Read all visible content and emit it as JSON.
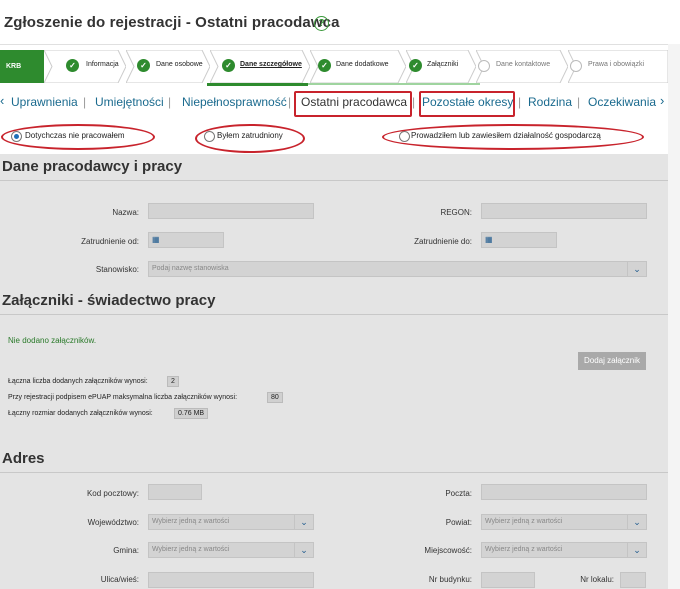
{
  "header": {
    "title": "Zgłoszenie do rejestracji - Ostatni pracodawca"
  },
  "steps": {
    "krb": "KRB",
    "items": [
      {
        "label": "Informacja"
      },
      {
        "label": "Dane osobowe"
      },
      {
        "label": "Dane szczegółowe"
      },
      {
        "label": "Dane dodatkowe"
      },
      {
        "label": "Załączniki"
      },
      {
        "label": "Dane kontaktowe"
      },
      {
        "label": "Prawa i obowiązki"
      }
    ]
  },
  "tabs": {
    "prev": "‹",
    "next": "›",
    "items": [
      "Uprawnienia",
      "Umiejętności",
      "Niepełnosprawność",
      "Ostatni pracodawca",
      "Pozostałe okresy",
      "Rodzina",
      "Oczekiwania"
    ]
  },
  "employment": {
    "options": [
      "Dotychczas nie pracowałem",
      "Byłem zatrudniony",
      "Prowadziłem lub zawiesiłem działalność gospodarczą"
    ]
  },
  "employer": {
    "title": "Dane pracodawcy i pracy",
    "name_label": "Nazwa:",
    "regon_label": "REGON:",
    "from_label": "Zatrudnienie od:",
    "to_label": "Zatrudnienie do:",
    "position_label": "Stanowisko:",
    "position_placeholder": "Podaj nazwę stanowiska"
  },
  "attachments": {
    "title": "Załączniki - świadectwo pracy",
    "none": "Nie dodano załączników.",
    "add_button": "Dodaj załącznik",
    "count_label": "Łączna liczba dodanych załączników wynosi:",
    "count_value": "2",
    "max_label": "Przy rejestracji podpisem ePUAP maksymalna liczba załączników wynosi:",
    "max_value": "80",
    "size_label": "Łączny rozmiar dodanych załączników wynosi:",
    "size_value": "0.76 MB"
  },
  "address": {
    "title": "Adres",
    "postal_label": "Kod pocztowy:",
    "post_label": "Poczta:",
    "voivodeship_label": "Województwo:",
    "county_label": "Powiat:",
    "commune_label": "Gmina:",
    "locality_label": "Miejscowość:",
    "street_label": "Ulica/wieś:",
    "building_label": "Nr budynku:",
    "flat_label": "Nr lokalu:",
    "select_placeholder": "Wybierz jedną z wartości"
  },
  "colors": {
    "green": "#2e8b2e",
    "red_highlight": "#c8232c",
    "link": "#1a6a8e"
  }
}
